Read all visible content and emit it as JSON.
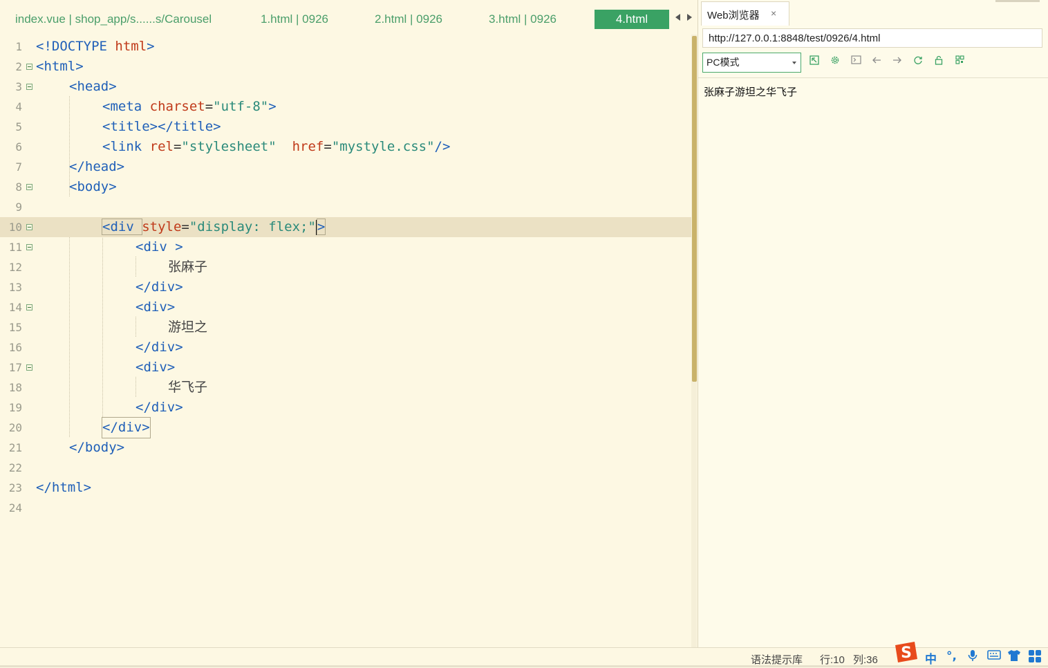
{
  "editor": {
    "tabs": [
      {
        "label": "index.vue | shop_app/s......s/Carousel"
      },
      {
        "label": "1.html | 0926"
      },
      {
        "label": "2.html | 0926"
      },
      {
        "label": "3.html | 0926"
      },
      {
        "label": "4.html"
      }
    ],
    "line_numbers": [
      "1",
      "2",
      "3",
      "4",
      "5",
      "6",
      "7",
      "8",
      "9",
      "10",
      "11",
      "12",
      "13",
      "14",
      "15",
      "16",
      "17",
      "18",
      "19",
      "20",
      "21",
      "22",
      "23",
      "24"
    ],
    "code": {
      "l1": [
        "<!DOCTYPE ",
        "html",
        ">"
      ],
      "l2": "<html>",
      "l3": "<head>",
      "l4": [
        "<meta ",
        "charset",
        "=",
        "\"utf-8\"",
        ">"
      ],
      "l5": "<title></title>",
      "l6": [
        "<link ",
        "rel",
        "=",
        "\"stylesheet\"",
        "  ",
        "href",
        "=",
        "\"mystyle.css\"",
        "/>"
      ],
      "l7": "</head>",
      "l8": "<body>",
      "l10": [
        "<div ",
        "style",
        "=",
        "\"display: flex;\"",
        ">"
      ],
      "l11": "<div >",
      "l12": "张麻子",
      "l13": "</div>",
      "l14": "<div>",
      "l15": "游坦之",
      "l16": "</div>",
      "l17": "<div>",
      "l18": "华飞子",
      "l19": "</div>",
      "l20": "</div>",
      "l21": "</body>",
      "l23": "</html>"
    }
  },
  "browser": {
    "tab_label": "Web浏览器",
    "close_glyph": "×",
    "url": "http://127.0.0.1:8848/test/0926/4.html",
    "mode": "PC模式",
    "content": "张麻子游坦之华飞子"
  },
  "status": {
    "syntax_lib": "语法提示库",
    "row": "行:10",
    "col": "列:36"
  },
  "ime": {
    "lang": "中",
    "punct": "°,"
  },
  "colors": {
    "tab_active": "#3aa264",
    "tag": "#1f5fb8",
    "attr": "#c03a1a",
    "string": "#2a8a7a"
  }
}
